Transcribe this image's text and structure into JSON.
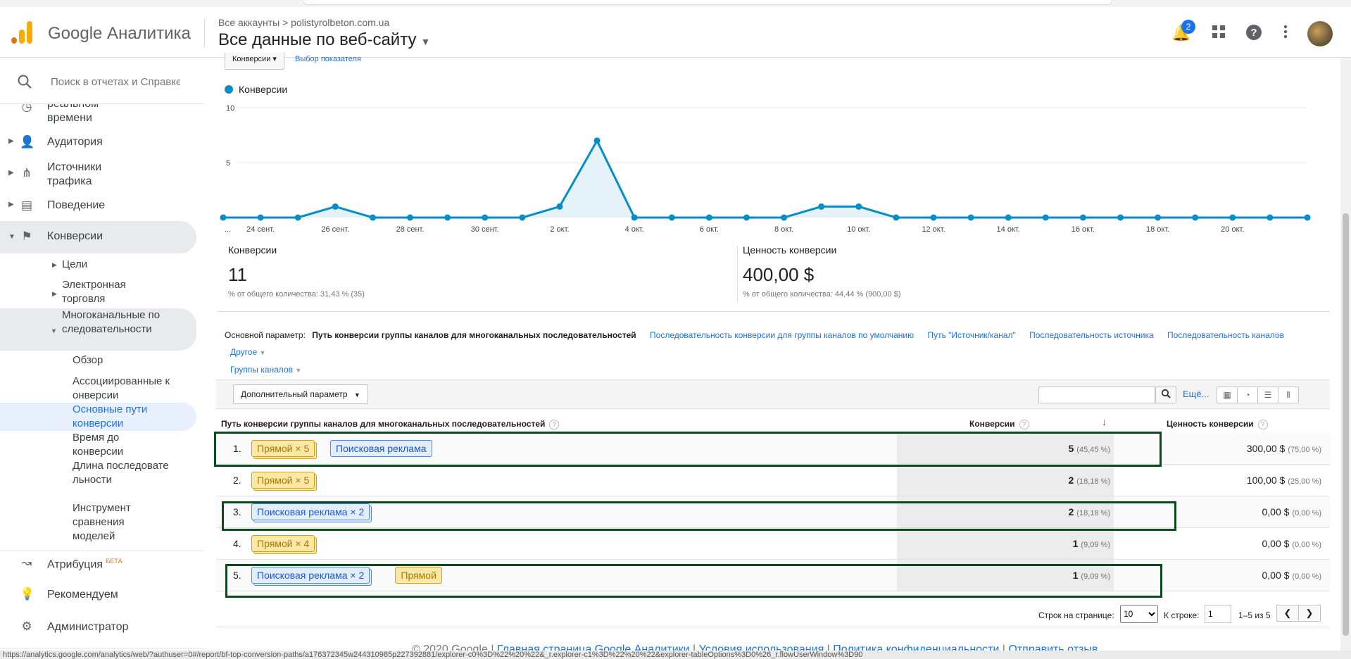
{
  "header": {
    "product": "Google Аналитика",
    "breadcrumb_account": "Все аккаунты",
    "breadcrumb_property": "polistyrolbeton.com.ua",
    "view_title": "Все данные по веб-сайту",
    "notifications_count": "2"
  },
  "sidebar": {
    "search_placeholder": "Поиск в отчетах и Справке",
    "realtime_label": "реальном\nвремени",
    "items": [
      {
        "label": "Аудитория",
        "icon": "person-icon"
      },
      {
        "label": "Источники трафика",
        "icon": "acquisition-icon"
      },
      {
        "label": "Поведение",
        "icon": "behavior-icon"
      },
      {
        "label": "Конверсии",
        "icon": "flag-icon"
      }
    ],
    "conv_sub": [
      "Цели",
      "Электронная торговля",
      "Многоканальные последовательности"
    ],
    "mcf_sub": [
      "Обзор",
      "Ассоциированные конверсии",
      "Основные пути конверсии",
      "Время до конверсии",
      "Длина последовательности",
      "Инструмент сравнения моделей"
    ],
    "bottom": [
      {
        "label": "Атрибуция",
        "badge": "БЕТА",
        "icon": "attribution-icon"
      },
      {
        "label": "Рекомендуем",
        "icon": "lightbulb-icon"
      },
      {
        "label": "Администратор",
        "icon": "gear-icon"
      }
    ]
  },
  "top_controls": {
    "metric_select": "Конверсии",
    "pick_metric": "Выбор показателя"
  },
  "chart_data": {
    "type": "line",
    "legend": "Конверсии",
    "ylim": [
      0,
      10
    ],
    "yticks": [
      "10",
      "5"
    ],
    "x_tick_labels": [
      "...",
      "24 сент.",
      "26 сент.",
      "28 сент.",
      "30 сент.",
      "2 окт.",
      "4 окт.",
      "6 окт.",
      "8 окт.",
      "10 окт.",
      "12 окт.",
      "14 окт.",
      "16 окт.",
      "18 окт.",
      "20 окт."
    ],
    "values": [
      0,
      0,
      0,
      1,
      0,
      0,
      0,
      0,
      0,
      1,
      7,
      0,
      0,
      0,
      0,
      0,
      1,
      1,
      0,
      0,
      0,
      0,
      0,
      0,
      0,
      0,
      0,
      0,
      0,
      0
    ],
    "color": "#058dc7"
  },
  "metrics": [
    {
      "title": "Конверсии",
      "value": "11",
      "sub": "% от общего количества: 31,43 % (35)"
    },
    {
      "title": "Ценность конверсии",
      "value": "400,00 $",
      "sub": "% от общего количества: 44,44 % (900,00 $)"
    }
  ],
  "dimensions": {
    "label": "Основной параметр:",
    "selected": "Путь конверсии группы каналов для многоканальных последовательностей",
    "links": [
      "Последовательность конверсии для группы каналов по умолчанию",
      "Путь \"Источник/канал\"",
      "Последовательность источника",
      "Последовательность каналов"
    ],
    "other": "Другое",
    "groups": "Группы каналов"
  },
  "toolbar": {
    "secondary": "Дополнительный параметр",
    "more": "Ещё..."
  },
  "table": {
    "col_path": "Путь конверсии группы каналов для многоканальных последовательностей",
    "col_conv": "Конверсии",
    "col_value": "Ценность конверсии",
    "rows": [
      {
        "n": "1.",
        "chips": [
          {
            "t": "Прямой × 5",
            "c": "y"
          },
          {
            "t": "Поисковая реклама",
            "c": "b"
          }
        ],
        "conv": "5",
        "conv_pct": "(45,45 %)",
        "val": "300,00 $",
        "val_pct": "(75,00 %)"
      },
      {
        "n": "2.",
        "chips": [
          {
            "t": "Прямой × 5",
            "c": "y"
          }
        ],
        "conv": "2",
        "conv_pct": "(18,18 %)",
        "val": "100,00 $",
        "val_pct": "(25,00 %)"
      },
      {
        "n": "3.",
        "chips": [
          {
            "t": "Поисковая реклама × 2",
            "c": "b"
          }
        ],
        "conv": "2",
        "conv_pct": "(18,18 %)",
        "val": "0,00 $",
        "val_pct": "(0,00 %)"
      },
      {
        "n": "4.",
        "chips": [
          {
            "t": "Прямой × 4",
            "c": "y"
          }
        ],
        "conv": "1",
        "conv_pct": "(9,09 %)",
        "val": "0,00 $",
        "val_pct": "(0,00 %)"
      },
      {
        "n": "5.",
        "chips": [
          {
            "t": "Поисковая реклама × 2",
            "c": "b"
          },
          {
            "t": "Прямой",
            "c": "y"
          }
        ],
        "conv": "1",
        "conv_pct": "(9,09 %)",
        "val": "0,00 $",
        "val_pct": "(0,00 %)"
      }
    ]
  },
  "pager": {
    "rows_label": "Строк на странице:",
    "rows_value": "10",
    "to_row": "К строке:",
    "to_row_value": "1",
    "range": "1–5 из 5"
  },
  "footer": {
    "text": "© 2020 Google | ",
    "links": [
      "Главная страница Google Аналитики",
      "Условия использования",
      "Политика конфиденциальности",
      "Отправить отзыв"
    ]
  },
  "statusbar": "https://analytics.google.com/analytics/web/?authuser=0#/report/bf-top-conversion-paths/a176372345w244310985p227392881/explorer-c0%3D%22%20%22&_r.explorer-c1%3D%22%20%22&explorer-tableOptions%3D0%26_r.flowUserWindow%3D90"
}
